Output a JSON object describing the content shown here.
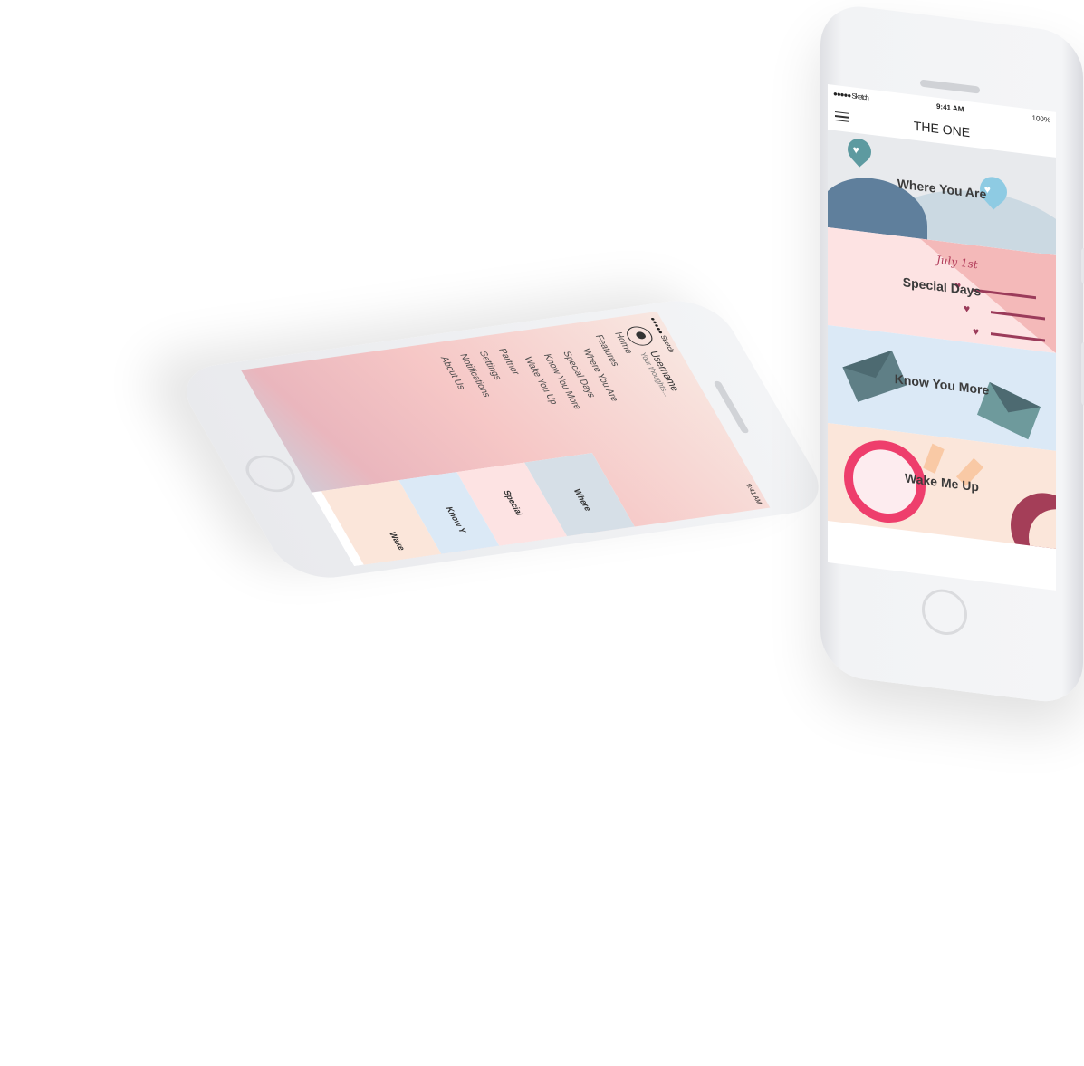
{
  "upright_phone": {
    "status": {
      "signal": "●●●●● Sketch",
      "time": "9:41 AM",
      "battery": "100%"
    },
    "app_title": "THE ONE",
    "cards": [
      {
        "label": "Where You Are"
      },
      {
        "label": "Special Days",
        "handwriting": "July 1st"
      },
      {
        "label": "Know You More"
      },
      {
        "label": "Wake Me Up"
      }
    ]
  },
  "tilted_phone": {
    "status": {
      "signal": "●●●●● Sketch",
      "time": "9:41 AM"
    },
    "profile": {
      "username": "Username",
      "thoughts": "Your thoughts..."
    },
    "menu": {
      "home": "Home",
      "features": "Features",
      "sub_items": [
        "Where You Are",
        "Special Days",
        "Know You More",
        "Wake You Up"
      ],
      "partner": "Partner",
      "settings": "Settings",
      "notifications": "Notifications",
      "about": "About Us"
    },
    "mini_cards": [
      "Where",
      "Special",
      "Know Y",
      "Wake"
    ]
  },
  "colors": {
    "accent_pink": "#ee3e6c",
    "navy": "#5f7f9c",
    "light_blue": "#dbe9f6",
    "rose": "#fde3e3",
    "peach": "#fbe6da"
  }
}
